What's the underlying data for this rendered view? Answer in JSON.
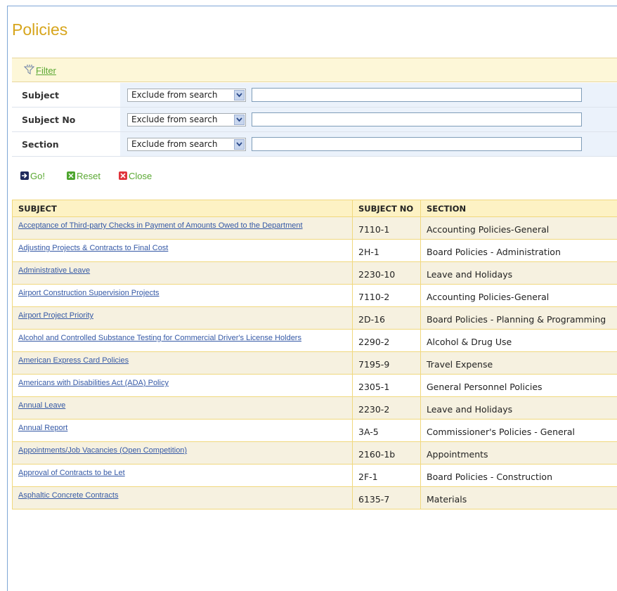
{
  "page": {
    "title": "Policies"
  },
  "filter": {
    "label": "Filter",
    "rows": [
      {
        "label": "Subject",
        "mode": "Exclude from search",
        "value": ""
      },
      {
        "label": "Subject No",
        "mode": "Exclude from search",
        "value": ""
      },
      {
        "label": "Section",
        "mode": "Exclude from search",
        "value": ""
      }
    ]
  },
  "actions": {
    "go": "Go!",
    "reset": "Reset",
    "close": "Close"
  },
  "table": {
    "headers": {
      "subject": "SUBJECT",
      "subject_no": "SUBJECT NO",
      "section": "SECTION"
    },
    "rows": [
      {
        "subject": "Acceptance of Third-party Checks in Payment of Amounts Owed to the Department",
        "subject_no": "7110-1",
        "section": "Accounting Policies-General"
      },
      {
        "subject": "Adjusting Projects & Contracts to Final Cost",
        "subject_no": "2H-1",
        "section": "Board Policies - Administration"
      },
      {
        "subject": "Administrative Leave",
        "subject_no": "2230-10",
        "section": "Leave and Holidays"
      },
      {
        "subject": "Airport Construction Supervision Projects",
        "subject_no": "7110-2",
        "section": "Accounting Policies-General"
      },
      {
        "subject": "Airport Project Priority",
        "subject_no": "2D-16",
        "section": "Board Policies - Planning & Programming"
      },
      {
        "subject": "Alcohol and Controlled Substance Testing for Commercial Driver's License Holders",
        "subject_no": "2290-2",
        "section": "Alcohol & Drug Use"
      },
      {
        "subject": "American Express Card Policies",
        "subject_no": "7195-9",
        "section": "Travel Expense"
      },
      {
        "subject": "Americans with Disabilities Act (ADA) Policy",
        "subject_no": "2305-1",
        "section": "General Personnel Policies"
      },
      {
        "subject": "Annual Leave",
        "subject_no": "2230-2",
        "section": "Leave and Holidays"
      },
      {
        "subject": "Annual Report",
        "subject_no": "3A-5",
        "section": "Commissioner's Policies - General"
      },
      {
        "subject": "Appointments/Job Vacancies (Open Competition)",
        "subject_no": "2160-1b",
        "section": "Appointments"
      },
      {
        "subject": "Approval of Contracts to be Let",
        "subject_no": "2F-1",
        "section": "Board Policies - Construction"
      },
      {
        "subject": "Asphaltic Concrete Contracts",
        "subject_no": "6135-7",
        "section": "Materials"
      }
    ]
  },
  "colors": {
    "title": "#d7a51c",
    "link": "#3559a6",
    "action_text": "#5aa832",
    "header_bg": "#fdf2c4",
    "alt_row_bg": "#f6f1e0"
  },
  "icons": {
    "filter": "funnel-icon",
    "go": "arrow-right-icon",
    "reset": "reset-icon",
    "close": "close-icon"
  }
}
